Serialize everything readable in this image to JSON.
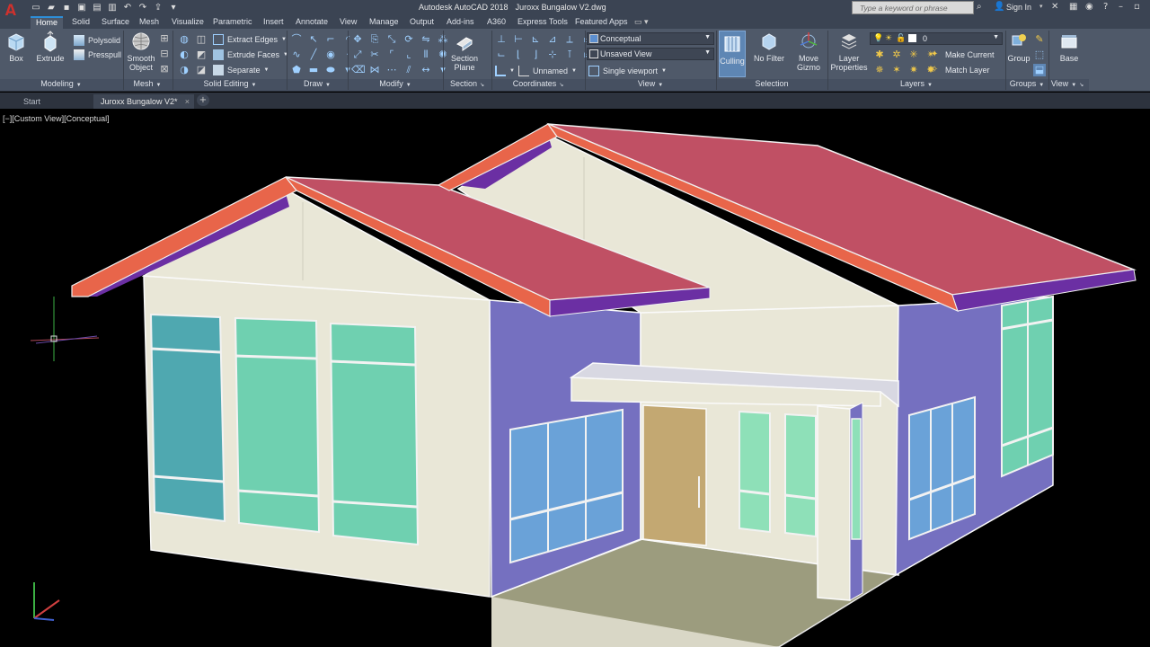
{
  "titlebar": {
    "app_name": "Autodesk AutoCAD 2018",
    "document": "Juroxx Bungalow V2.dwg",
    "search_placeholder": "Type a keyword or phrase",
    "signin": "Sign In"
  },
  "tabs": [
    {
      "label": "Home",
      "active": true
    },
    {
      "label": "Solid"
    },
    {
      "label": "Surface"
    },
    {
      "label": "Mesh"
    },
    {
      "label": "Visualize"
    },
    {
      "label": "Parametric"
    },
    {
      "label": "Insert"
    },
    {
      "label": "Annotate"
    },
    {
      "label": "View"
    },
    {
      "label": "Manage"
    },
    {
      "label": "Output"
    },
    {
      "label": "Add-ins"
    },
    {
      "label": "A360"
    },
    {
      "label": "Express Tools"
    },
    {
      "label": "Featured Apps"
    }
  ],
  "ribbon": {
    "modeling": {
      "label": "Modeling",
      "box": "Box",
      "extrude": "Extrude",
      "polysolid": "Polysolid",
      "presspull": "Presspull"
    },
    "mesh": {
      "label": "Mesh",
      "smooth_object": [
        "Smooth",
        "Object"
      ]
    },
    "solid_editing": {
      "label": "Solid Editing",
      "extract_edges": "Extract Edges",
      "extrude_faces": "Extrude Faces",
      "separate": "Separate"
    },
    "draw": {
      "label": "Draw"
    },
    "modify": {
      "label": "Modify"
    },
    "section": {
      "label": "Section",
      "section_plane": [
        "Section",
        "Plane"
      ]
    },
    "coordinates": {
      "label": "Coordinates",
      "ucs_name": "Unnamed"
    },
    "view": {
      "label": "View",
      "visual_style": "Conceptual",
      "named_view": "Unsaved View",
      "viewport_config": "Single viewport"
    },
    "selection": {
      "label": "Selection",
      "culling": "Culling",
      "no_filter": "No Filter",
      "move_gizmo": [
        "Move",
        "Gizmo"
      ]
    },
    "layers": {
      "label": "Layers",
      "layer_properties": [
        "Layer",
        "Properties"
      ],
      "current_layer": "0",
      "make_current": "Make Current",
      "match_layer": "Match Layer"
    },
    "groups": {
      "label": "Groups",
      "group": "Group"
    },
    "view2": {
      "label": "View",
      "base": "Base"
    }
  },
  "doc_tabs": [
    {
      "label": "Start"
    },
    {
      "label": "Juroxx Bungalow V2*",
      "active": true
    }
  ],
  "viewport": {
    "label": "[−][Custom View][Conceptual]"
  },
  "colors": {
    "roof": "#c05064",
    "fascia": "#e8654a",
    "soffit": "#6b2fa3",
    "wall_cream": "#e9e7d7",
    "wall_purple": "#7570c0",
    "glass": "#6fc9b4",
    "door": "#c3a872",
    "floor": "#9c9c7e",
    "accent": "#2d8ed8"
  }
}
